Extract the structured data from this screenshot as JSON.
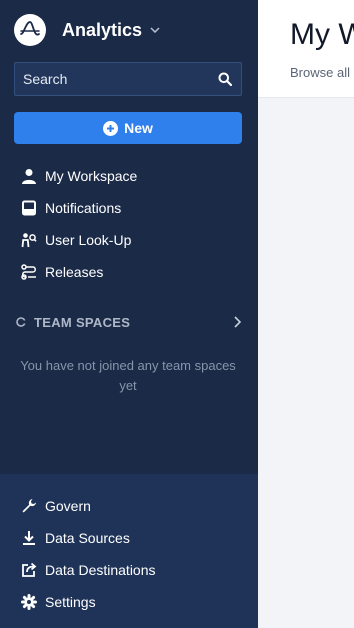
{
  "brand": {
    "name": "Analytics"
  },
  "search": {
    "placeholder": "Search"
  },
  "new_button": {
    "label": "New"
  },
  "nav": [
    {
      "label": "My Workspace",
      "icon": "person-icon"
    },
    {
      "label": "Notifications",
      "icon": "inbox-icon"
    },
    {
      "label": "User Look-Up",
      "icon": "user-lookup-icon"
    },
    {
      "label": "Releases",
      "icon": "releases-icon"
    }
  ],
  "team_spaces": {
    "label": "TEAM SPACES",
    "empty_message": "You have not joined any team spaces yet"
  },
  "bottom_nav": [
    {
      "label": "Govern",
      "icon": "wrench-icon"
    },
    {
      "label": "Data Sources",
      "icon": "download-icon"
    },
    {
      "label": "Data Destinations",
      "icon": "export-icon"
    },
    {
      "label": "Settings",
      "icon": "gear-icon"
    }
  ],
  "main": {
    "title": "My W",
    "subtitle": "Browse all"
  },
  "colors": {
    "sidebar_bg": "#1b2a47",
    "sidebar_bottom_bg": "#1f3358",
    "accent": "#2f80ed"
  }
}
